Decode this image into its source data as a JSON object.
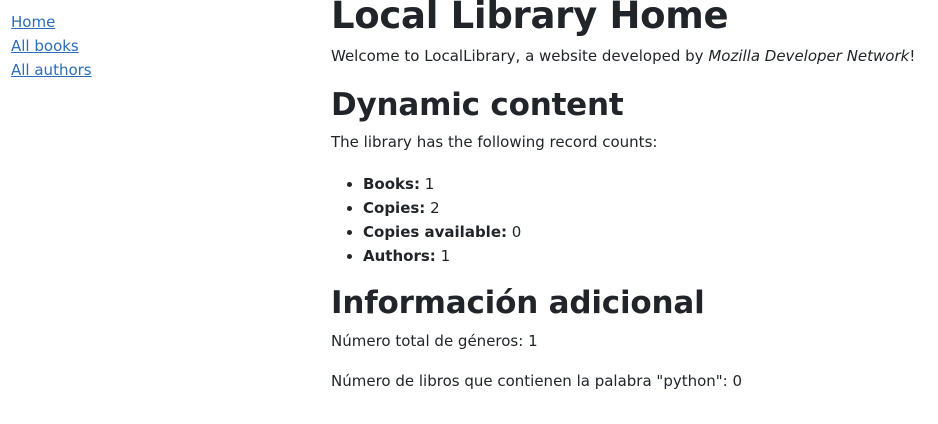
{
  "sidebar": {
    "links": [
      {
        "label": "Home"
      },
      {
        "label": "All books"
      },
      {
        "label": "All authors"
      }
    ]
  },
  "main": {
    "title": "Local Library Home",
    "welcome": {
      "prefix": "Welcome to LocalLibrary, a website developed by ",
      "emphasis": "Mozilla Developer Network",
      "suffix": "!"
    },
    "dynamic_heading": "Dynamic content",
    "counts_intro": "The library has the following record counts:",
    "counts": [
      {
        "label": "Books:",
        "value": "1"
      },
      {
        "label": "Copies:",
        "value": "2"
      },
      {
        "label": "Copies available:",
        "value": "0"
      },
      {
        "label": "Authors:",
        "value": "1"
      }
    ],
    "info_heading": "Información adicional",
    "genres_text": "Número total de géneros: 1",
    "python_text": "Número de libros que contienen la palabra \"python\": 0"
  }
}
